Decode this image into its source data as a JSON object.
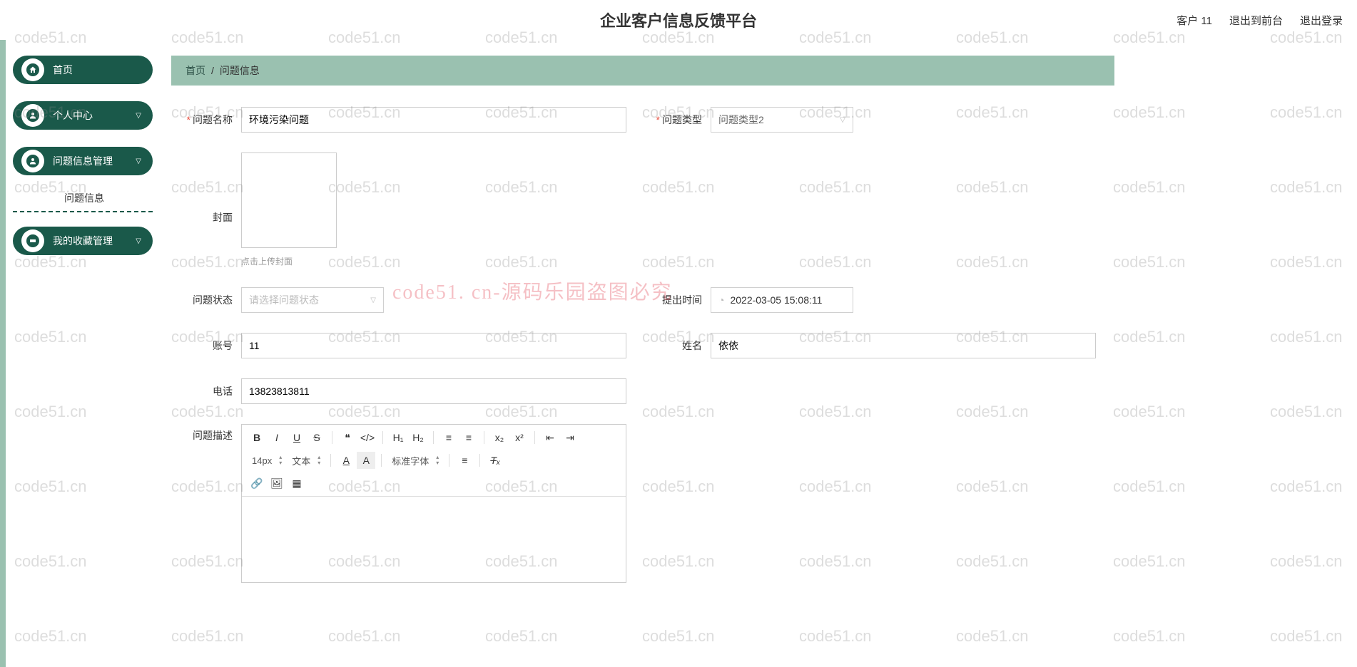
{
  "header": {
    "title": "企业客户信息反馈平台",
    "user_label": "客户 11",
    "exit_front": "退出到前台",
    "logout": "退出登录"
  },
  "sidebar": {
    "items": [
      {
        "label": "首页",
        "icon": "home"
      },
      {
        "label": "个人中心",
        "icon": "user",
        "expandable": true
      },
      {
        "label": "问题信息管理",
        "icon": "user",
        "expandable": true,
        "expanded": true,
        "children": [
          {
            "label": "问题信息"
          }
        ]
      },
      {
        "label": "我的收藏管理",
        "icon": "ticket",
        "expandable": true
      }
    ]
  },
  "breadcrumb": {
    "home": "首页",
    "current": "问题信息"
  },
  "form": {
    "question_name": {
      "label": "问题名称",
      "value": "环境污染问题"
    },
    "question_type": {
      "label": "问题类型",
      "value": "问题类型2"
    },
    "cover": {
      "label": "封面",
      "hint": "点击上传封面"
    },
    "question_status": {
      "label": "问题状态",
      "placeholder": "请选择问题状态"
    },
    "submit_time": {
      "label": "提出时间",
      "value": "2022-03-05 15:08:11"
    },
    "account": {
      "label": "账号",
      "value": "11"
    },
    "name": {
      "label": "姓名",
      "value": "依依"
    },
    "phone": {
      "label": "电话",
      "value": "13823813811"
    },
    "description": {
      "label": "问题描述"
    }
  },
  "editor_toolbar": {
    "font_size": "14px",
    "format": "文本",
    "font_family": "标准字体"
  },
  "watermark": {
    "repeat": "code51.cn",
    "banner": "code51. cn-源码乐园盗图必究"
  }
}
